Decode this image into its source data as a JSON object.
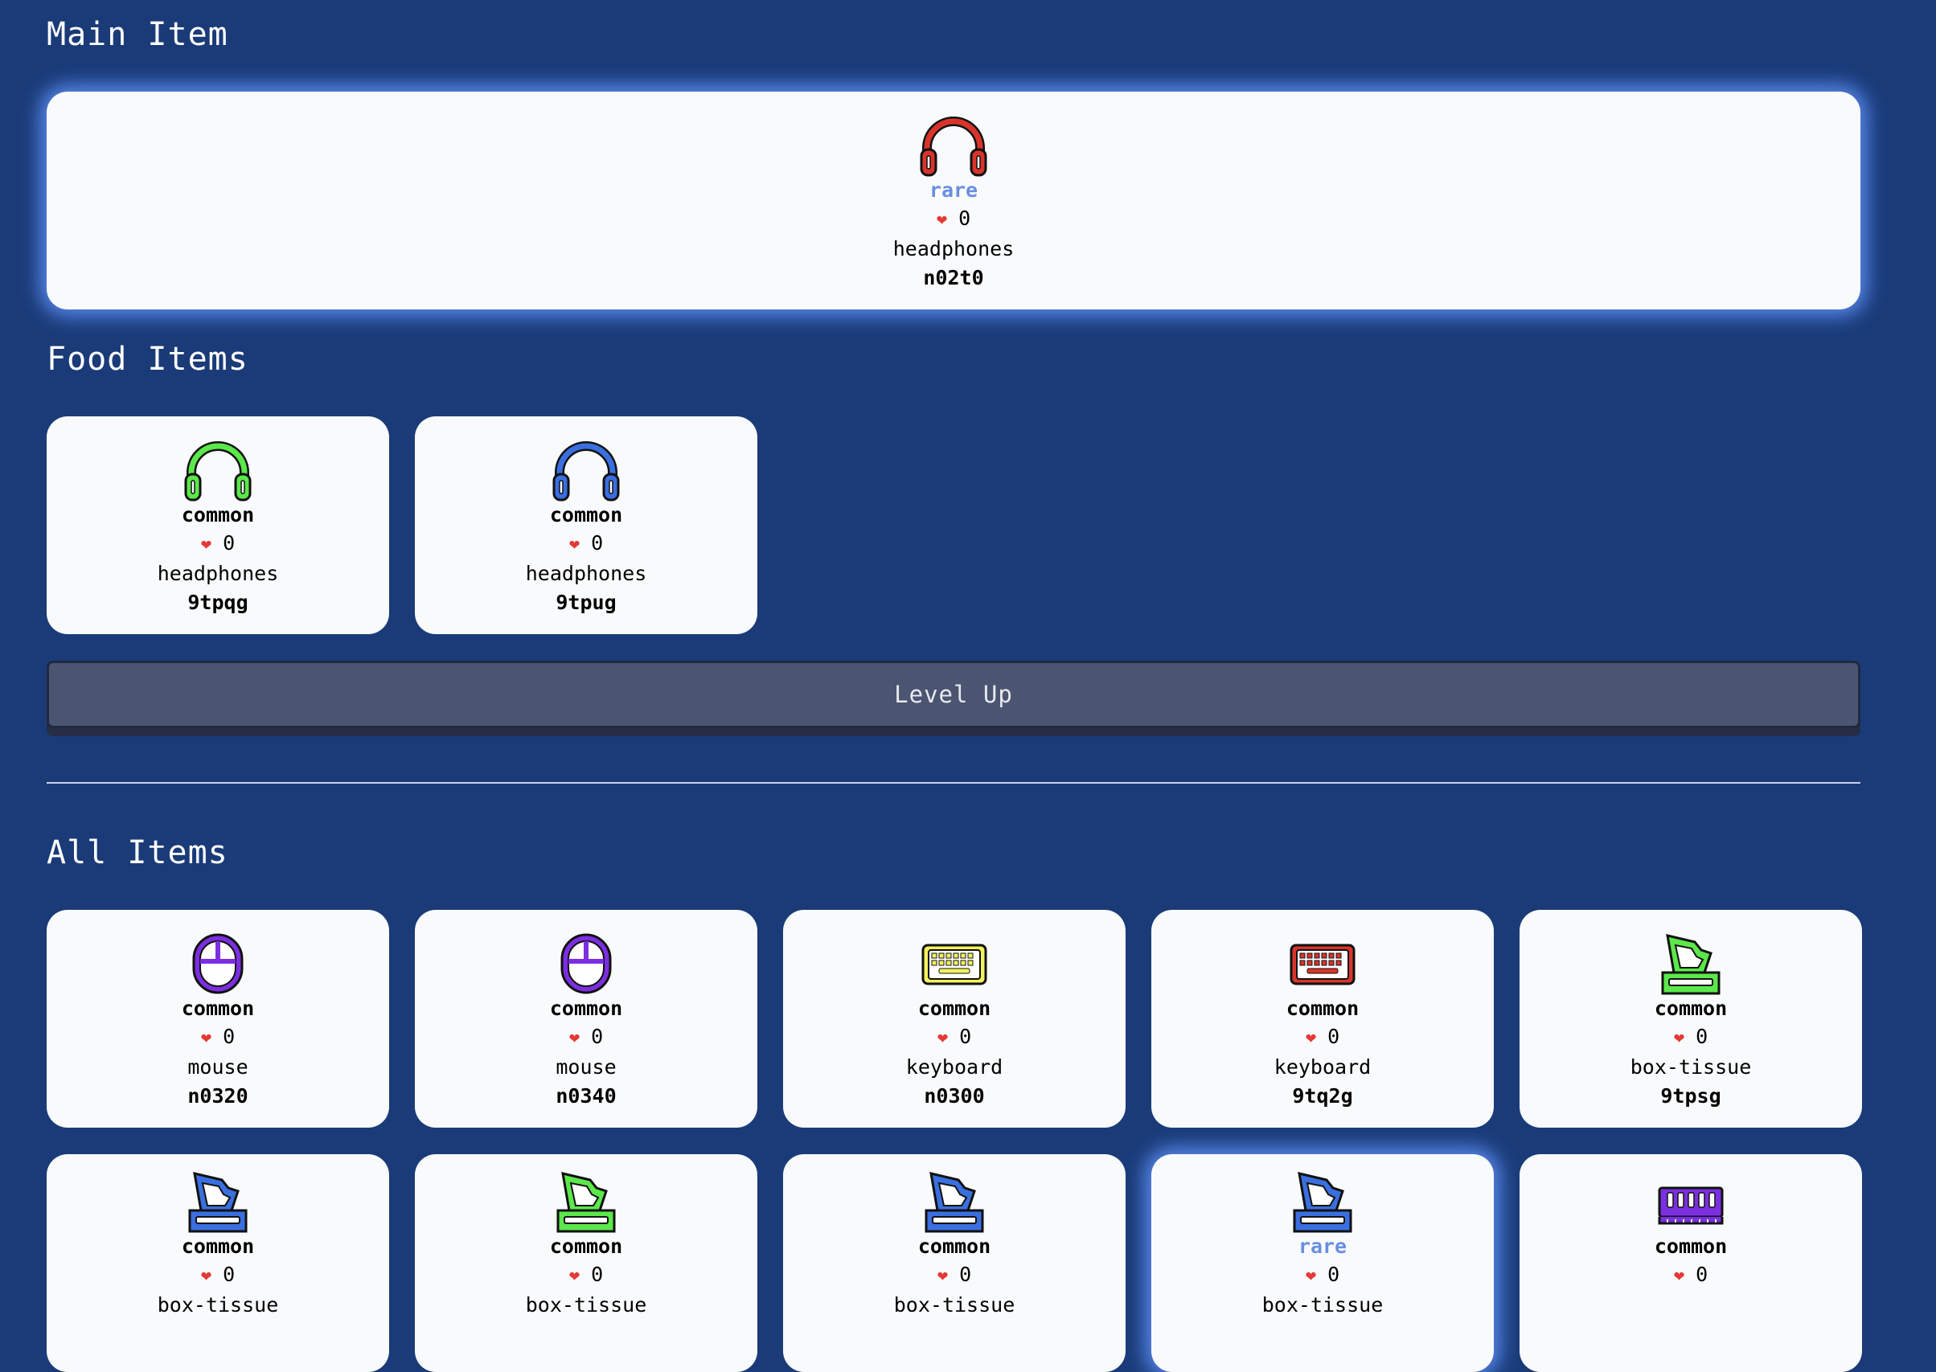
{
  "main_section": {
    "title": "Main Item",
    "item": {
      "icon": "headphones-icon",
      "color": "#d9342b",
      "rarity": "rare",
      "likes": "0",
      "name": "headphones",
      "code": "n02t0"
    }
  },
  "food_section": {
    "title": "Food Items",
    "items": [
      {
        "icon": "headphones-icon",
        "color": "#5be84a",
        "rarity": "common",
        "likes": "0",
        "name": "headphones",
        "code": "9tpqg"
      },
      {
        "icon": "headphones-icon",
        "color": "#3a6fe0",
        "rarity": "common",
        "likes": "0",
        "name": "headphones",
        "code": "9tpug"
      }
    ]
  },
  "level_up_label": "Level Up",
  "all_section": {
    "title": "All Items",
    "items": [
      {
        "icon": "mouse-icon",
        "color": "#7b2fe0",
        "rarity": "common",
        "likes": "0",
        "name": "mouse",
        "code": "n0320"
      },
      {
        "icon": "mouse-icon",
        "color": "#7b2fe0",
        "rarity": "common",
        "likes": "0",
        "name": "mouse",
        "code": "n0340"
      },
      {
        "icon": "keyboard-icon",
        "color": "#f2f25a",
        "rarity": "common",
        "likes": "0",
        "name": "keyboard",
        "code": "n0300"
      },
      {
        "icon": "keyboard-icon",
        "color": "#d9342b",
        "rarity": "common",
        "likes": "0",
        "name": "keyboard",
        "code": "9tq2g"
      },
      {
        "icon": "box-tissue-icon",
        "color": "#5be84a",
        "rarity": "common",
        "likes": "0",
        "name": "box-tissue",
        "code": "9tpsg"
      },
      {
        "icon": "box-tissue-icon",
        "color": "#3a6fe0",
        "rarity": "common",
        "likes": "0",
        "name": "box-tissue",
        "code": ""
      },
      {
        "icon": "box-tissue-icon",
        "color": "#5be84a",
        "rarity": "common",
        "likes": "0",
        "name": "box-tissue",
        "code": ""
      },
      {
        "icon": "box-tissue-icon",
        "color": "#3a6fe0",
        "rarity": "common",
        "likes": "0",
        "name": "box-tissue",
        "code": ""
      },
      {
        "icon": "box-tissue-icon",
        "color": "#3a6fe0",
        "rarity": "rare",
        "likes": "0",
        "name": "box-tissue",
        "code": ""
      },
      {
        "icon": "memory-icon",
        "color": "#7b2fe0",
        "rarity": "common",
        "likes": "0",
        "name": "",
        "code": ""
      }
    ]
  }
}
